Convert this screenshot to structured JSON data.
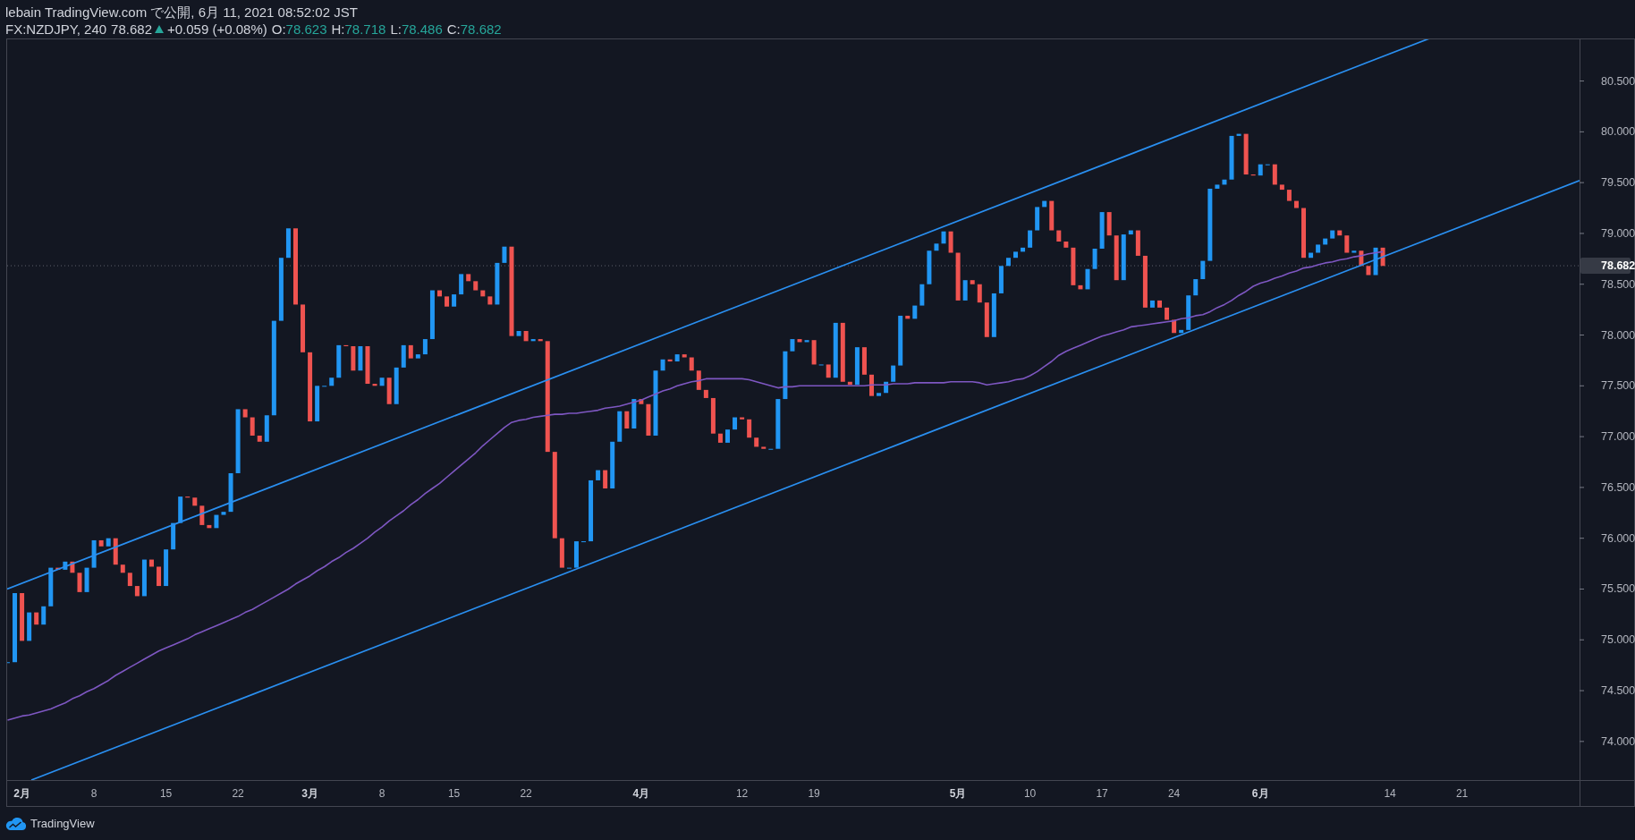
{
  "header": {
    "title": "lebain TradingView.com で公開, 6月 11, 2021 08:52:02 JST"
  },
  "legend": {
    "symbol": "FX:NZDJPY, 240",
    "last": "78.682",
    "change": {
      "positive": true,
      "text": "+0.059 (+0.08%)"
    },
    "ohlc": [
      {
        "label": "O:",
        "value": "78.623"
      },
      {
        "label": "H:",
        "value": "78.718"
      },
      {
        "label": "L:",
        "value": "78.486"
      },
      {
        "label": "C:",
        "value": "78.682"
      }
    ]
  },
  "chart": {
    "price_axis": {
      "labels": [
        "80.500",
        "80.000",
        "79.500",
        "79.000",
        "78.500",
        "78.000",
        "77.500",
        "77.000",
        "76.500",
        "76.000",
        "75.500",
        "75.000",
        "74.500",
        "74.000"
      ]
    },
    "last_price": {
      "label": "78.682"
    },
    "time_axis": {
      "labels": [
        {
          "text": "2月",
          "kind": "month"
        },
        {
          "text": "8",
          "kind": "day"
        },
        {
          "text": "15",
          "kind": "day"
        },
        {
          "text": "22",
          "kind": "day"
        },
        {
          "text": "3月",
          "kind": "month"
        },
        {
          "text": "8",
          "kind": "day"
        },
        {
          "text": "15",
          "kind": "day"
        },
        {
          "text": "22",
          "kind": "day"
        },
        {
          "text": "4月",
          "kind": "month"
        },
        {
          "text": "12",
          "kind": "day"
        },
        {
          "text": "19",
          "kind": "day"
        },
        {
          "text": "5月",
          "kind": "month"
        },
        {
          "text": "10",
          "kind": "day"
        },
        {
          "text": "17",
          "kind": "day"
        },
        {
          "text": "24",
          "kind": "day"
        },
        {
          "text": "6月",
          "kind": "month"
        },
        {
          "text": "14",
          "kind": "day"
        },
        {
          "text": "21",
          "kind": "day"
        }
      ]
    }
  },
  "footer": {
    "brand": "TradingView"
  }
}
